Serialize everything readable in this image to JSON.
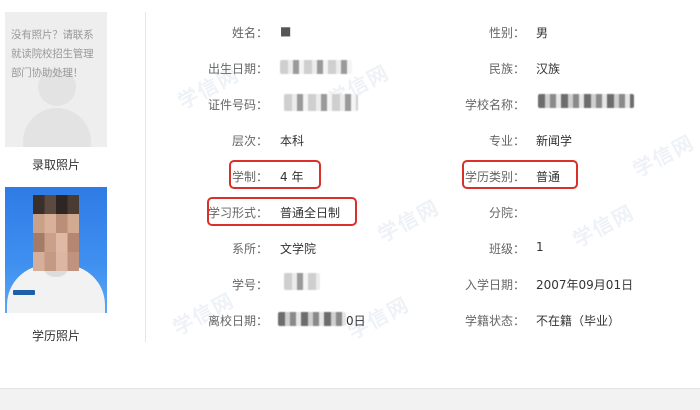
{
  "photos": {
    "no_photo_message": "没有照片？请联系就读院校招生管理部门协助处理！",
    "admission_label": "录取照片",
    "degree_label": "学历照片"
  },
  "fields": {
    "name": {
      "label": "姓名：",
      "value": "■"
    },
    "gender": {
      "label": "性别：",
      "value": "男"
    },
    "birth_date": {
      "label": "出生日期：",
      "value": ""
    },
    "ethnicity": {
      "label": "民族：",
      "value": "汉族"
    },
    "id_number": {
      "label": "证件号码：",
      "value": ""
    },
    "school_name": {
      "label": "学校名称：",
      "value": ""
    },
    "level": {
      "label": "层次：",
      "value": "本科"
    },
    "major": {
      "label": "专业：",
      "value": "新闻学"
    },
    "duration": {
      "label": "学制：",
      "value": "4 年"
    },
    "education_type": {
      "label": "学历类别：",
      "value": "普通"
    },
    "study_form": {
      "label": "学习形式：",
      "value": "普通全日制"
    },
    "branch": {
      "label": "分院：",
      "value": ""
    },
    "department": {
      "label": "系所：",
      "value": "文学院"
    },
    "class": {
      "label": "班级：",
      "value": "1"
    },
    "student_id": {
      "label": "学号：",
      "value": ""
    },
    "enrollment_date": {
      "label": "入学日期：",
      "value": "2007年09月01日"
    },
    "leave_date": {
      "label": "离校日期：",
      "value": "0日"
    },
    "status": {
      "label": "学籍状态：",
      "value": "不在籍（毕业）"
    }
  },
  "watermark_text": "学信网",
  "highlight_color": "#d9302a"
}
